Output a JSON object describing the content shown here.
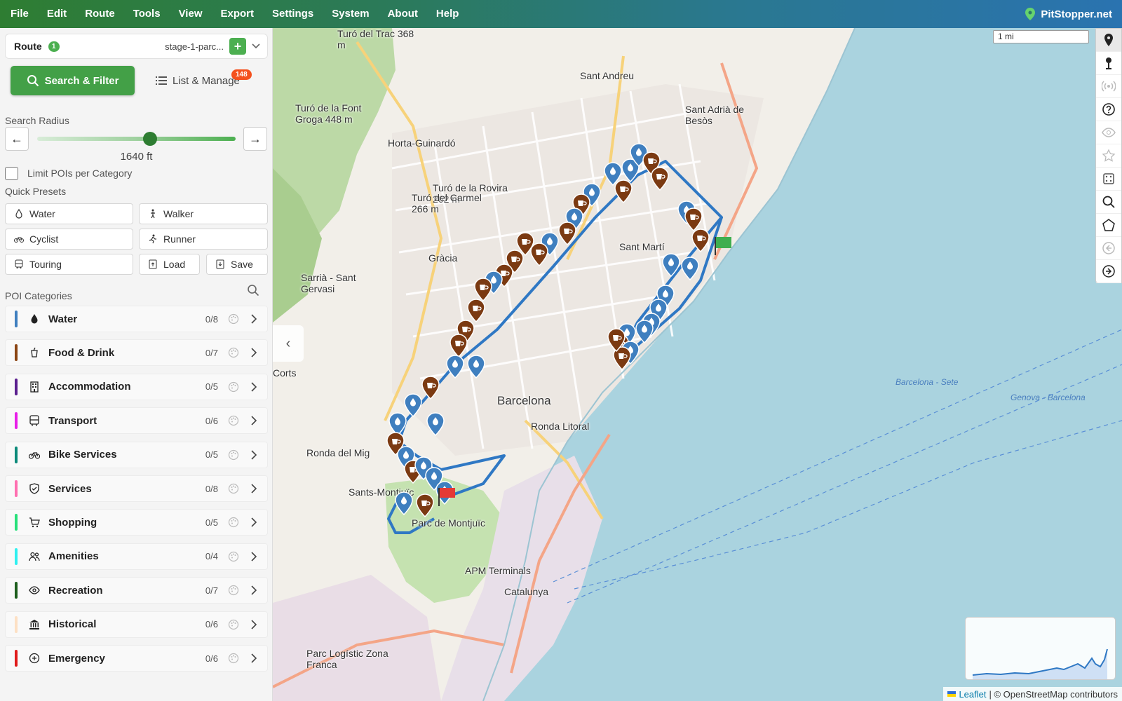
{
  "menu": [
    "File",
    "Edit",
    "Route",
    "Tools",
    "View",
    "Export",
    "Settings",
    "System",
    "About",
    "Help"
  ],
  "brand": "PitStopper.net",
  "route": {
    "label": "Route",
    "count": "1",
    "name": "stage-1-parc...",
    "add_label": "+"
  },
  "tabs": {
    "search": "Search & Filter",
    "list": "List & Manage",
    "list_badge": "148"
  },
  "search_radius": {
    "label": "Search Radius",
    "value_text": "1640 ft",
    "level_fraction": 0.57
  },
  "limit_checkbox": {
    "label": "Limit POIs per Category",
    "checked": false
  },
  "presets": {
    "heading": "Quick Presets",
    "items": [
      "Water",
      "Walker",
      "Cyclist",
      "Runner",
      "Touring",
      "Load",
      "Save"
    ]
  },
  "categories": {
    "heading": "POI Categories",
    "items": [
      {
        "name": "Water",
        "count": "0/8",
        "color": "#3f7fbf",
        "icon": "drop-icon"
      },
      {
        "name": "Food & Drink",
        "count": "0/7",
        "color": "#8b4513",
        "icon": "cup-icon"
      },
      {
        "name": "Accommodation",
        "count": "0/5",
        "color": "#5b1f8f",
        "icon": "building-icon"
      },
      {
        "name": "Transport",
        "count": "0/6",
        "color": "#e81ee8",
        "icon": "bus-icon"
      },
      {
        "name": "Bike Services",
        "count": "0/5",
        "color": "#0b8a7a",
        "icon": "bike-icon"
      },
      {
        "name": "Services",
        "count": "0/8",
        "color": "#ff6fb0",
        "icon": "shield-icon"
      },
      {
        "name": "Shopping",
        "count": "0/5",
        "color": "#27e07a",
        "icon": "cart-icon"
      },
      {
        "name": "Amenities",
        "count": "0/4",
        "color": "#2ff0f0",
        "icon": "people-icon"
      },
      {
        "name": "Recreation",
        "count": "0/7",
        "color": "#1d5e1d",
        "icon": "eye-icon"
      },
      {
        "name": "Historical",
        "count": "0/6",
        "color": "#fde0c4",
        "icon": "museum-icon"
      },
      {
        "name": "Emergency",
        "count": "0/6",
        "color": "#e01b1b",
        "icon": "plus-circle-icon"
      }
    ]
  },
  "map": {
    "scale": "1 mi",
    "attribution_link": "Leaflet",
    "attribution_text": "| © OpenStreetMap contributors",
    "labels": [
      "Barcelona",
      "Sant Andreu",
      "Sant Adrià de Besòs",
      "Horta-Guinardó",
      "Gràcia",
      "Sant Martí",
      "Sarrià - Sant Gervasi",
      "Sants-Montjuïc",
      "Corts",
      "Parc de Montjuïc",
      "APM Terminals",
      "Turó de la Rovira 262 m",
      "Turó del Carmel 266 m",
      "Turó de la Font Groga 448 m",
      "Turó del Trac 368 m",
      "Parc Logístic Zona Franca",
      "Barcelona - Sete",
      "Genova - Barcelona",
      "Ronda Litoral",
      "Ronda del Mig",
      "Catalunya"
    ]
  },
  "toolbar_icons": [
    "map-pin-icon",
    "pushpin-icon",
    "radio-icon",
    "help-icon",
    "eye-icon",
    "star-icon",
    "dice-icon",
    "search-icon",
    "polygon-icon",
    "back-icon",
    "forward-icon"
  ],
  "colors": {
    "accent": "#43a047",
    "badge": "#f4511e",
    "route": "#2f78c4",
    "water_pin": "#3f7fbf",
    "food_pin": "#7b3a12"
  }
}
